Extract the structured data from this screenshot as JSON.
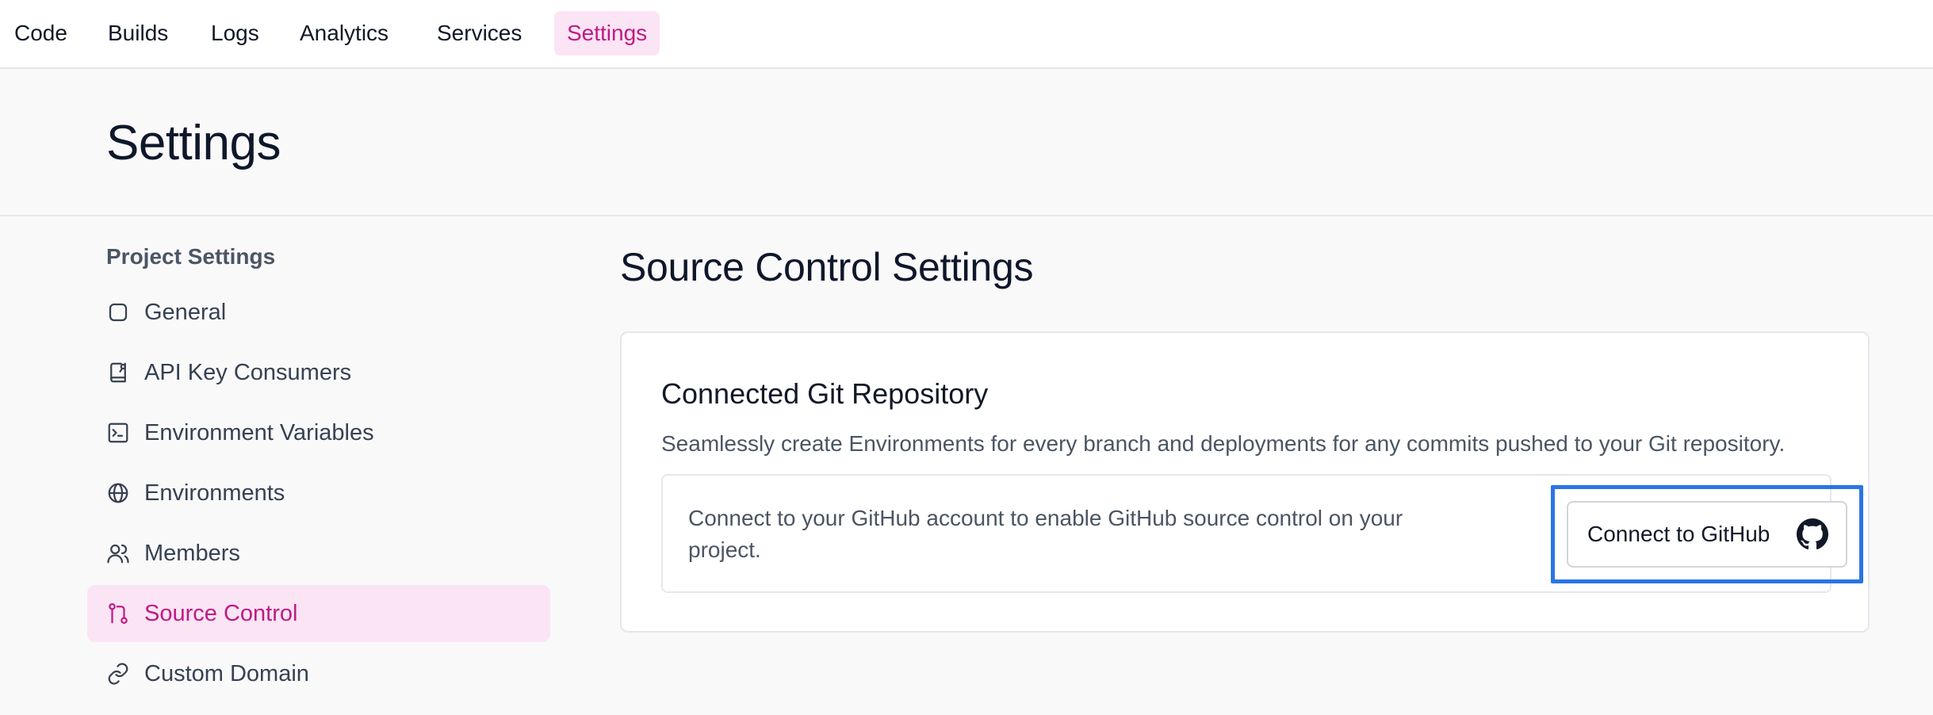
{
  "topnav": {
    "items": [
      "Code",
      "Builds",
      "Logs",
      "Analytics",
      "Services",
      "Settings"
    ],
    "active": "Settings"
  },
  "header": {
    "title": "Settings"
  },
  "sidebar": {
    "heading": "Project Settings",
    "items": [
      {
        "label": "General",
        "icon": "square-icon"
      },
      {
        "label": "API Key Consumers",
        "icon": "book-key-icon"
      },
      {
        "label": "Environment Variables",
        "icon": "terminal-icon"
      },
      {
        "label": "Environments",
        "icon": "globe-icon"
      },
      {
        "label": "Members",
        "icon": "users-icon"
      },
      {
        "label": "Source Control",
        "icon": "git-pull-request-icon"
      },
      {
        "label": "Custom Domain",
        "icon": "link-icon"
      }
    ],
    "active": "Source Control"
  },
  "main": {
    "title": "Source Control Settings",
    "card": {
      "title": "Connected Git Repository",
      "description": "Seamlessly create Environments for every branch and deployments for any commits pushed to your Git repository.",
      "connect_text": "Connect to your GitHub account to enable GitHub source control on your project.",
      "button_label": "Connect to GitHub",
      "button_icon": "github-icon"
    }
  },
  "colors": {
    "accent": "#be1b84",
    "accent_bg": "#fbe4f4",
    "highlight_border": "#2b74e6"
  }
}
